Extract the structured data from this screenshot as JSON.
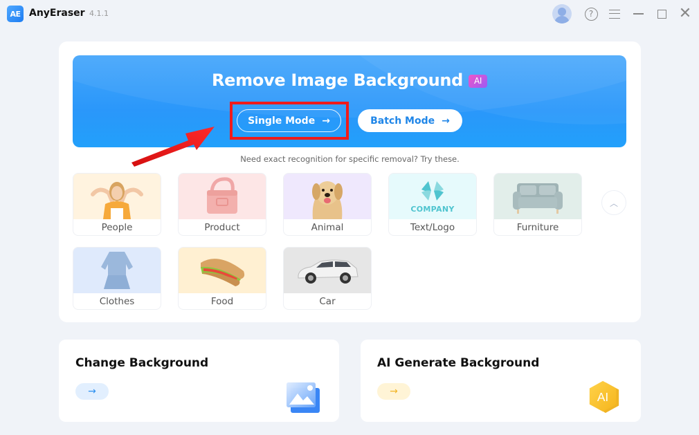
{
  "titlebar": {
    "logo_text": "AE",
    "app_name": "AnyEraser",
    "version": "4.1.1",
    "icons": [
      "avatar-icon",
      "help-icon",
      "menu-icon",
      "minimize-icon",
      "maximize-icon",
      "close-icon"
    ],
    "help_glyph": "?",
    "close_glyph": "✕"
  },
  "hero": {
    "title": "Remove Image Background",
    "ai_badge": "AI",
    "single_mode_label": "Single Mode",
    "batch_mode_label": "Batch Mode",
    "arrow_glyph": "→",
    "accent_color": "#2a97fa",
    "highlight_color": "#f01b1b"
  },
  "hint": "Need exact recognition for specific removal? Try these.",
  "categories": [
    {
      "label": "People",
      "bg": "#fff3df"
    },
    {
      "label": "Product",
      "bg": "#fde6e6"
    },
    {
      "label": "Animal",
      "bg": "#efe8fd"
    },
    {
      "label": "Text/Logo",
      "bg": "#e6fafc",
      "logo_text": "COMPANY"
    },
    {
      "label": "Furniture",
      "bg": "#e2eeea"
    },
    {
      "label": "Clothes",
      "bg": "#dfeafc"
    },
    {
      "label": "Food",
      "bg": "#fff0d2"
    },
    {
      "label": "Car",
      "bg": "#e6e6e6"
    }
  ],
  "scroll_up_glyph": "︿",
  "features": [
    {
      "title": "Change Background",
      "arrow": "→"
    },
    {
      "title": "AI Generate Background",
      "arrow": "→",
      "icon_text": "AI"
    }
  ]
}
